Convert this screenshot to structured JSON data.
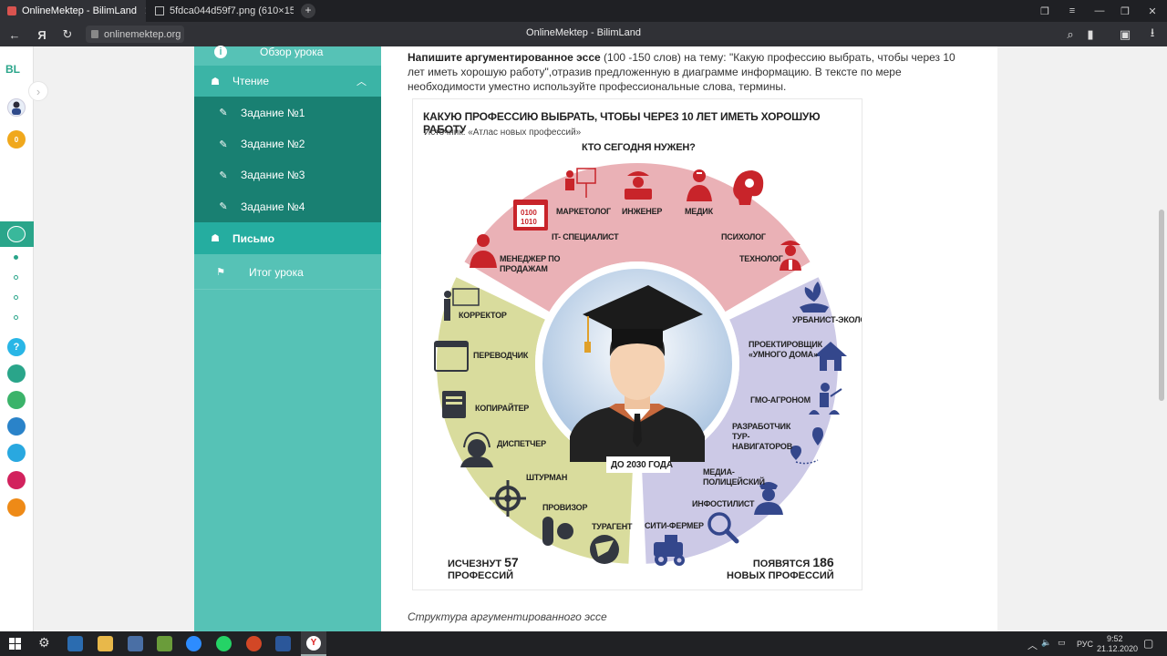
{
  "browser": {
    "tabs": [
      {
        "title": "OnlineMektep - BilimLand",
        "active": true
      },
      {
        "title": "5fdca044d59f7.png (610×15",
        "active": false
      }
    ],
    "url": "onlinemektep.org",
    "page_title": "OnlineMektep - BilimLand"
  },
  "rail": {
    "logo": "BL",
    "points": "0"
  },
  "sidebar": {
    "overview_label": "Обзор урока",
    "reading_label": "Чтение",
    "tasks": [
      "Задание №1",
      "Задание №2",
      "Задание №3",
      "Задание №4"
    ],
    "writing_label": "Письмо",
    "result_label": "Итог урока"
  },
  "content": {
    "task_bold": "Напишите аргументированное эссе",
    "task_rest": " (100 -150 слов) на тему: \"Какую профессию выбрать, чтобы через 10 лет иметь хорошую работу\",отразив предложенную в диаграмме информацию. В тексте по мере необходимости уместно используйте профессиональные слова, термины.",
    "caption": "Структура аргументированного эссе"
  },
  "infographic": {
    "title": "КАКУЮ ПРОФЕССИЮ ВЫБРАТЬ, ЧТОБЫ ЧЕРЕЗ 10 ЛЕТ ИМЕТЬ ХОРОШУЮ РАБОТУ",
    "source": "Источник: «Атлас новых профессий»",
    "needed_title": "КТО СЕГОДНЯ НУЖЕН?",
    "center_label": "ДО 2030 ГОДА",
    "needed": [
      "МАРКЕТОЛОГ",
      "ИНЖЕНЕР",
      "МЕДИК",
      "IT- СПЕЦИАЛИСТ",
      "ПСИХОЛОГ",
      "МЕНЕДЖЕР ПО ПРОДАЖАМ",
      "ТЕХНОЛОГ"
    ],
    "disappear": [
      "КОРРЕКТОР",
      "ПЕРЕВОДЧИК",
      "КОПИРАЙТЕР",
      "ДИСПЕТЧЕР",
      "ШТУРМАН",
      "ПРОВИЗОР",
      "ТУРАГЕНТ"
    ],
    "appear": [
      "УРБАНИСТ-ЭКОЛОГ",
      "ПРОЕКТИРОВЩИК «УМНОГО ДОМА»",
      "ГМО-АГРОНОМ",
      "РАЗРАБОТЧИК ТУР-НАВИГАТОРОВ",
      "МЕДИА- ПОЛИЦЕЙСКИЙ",
      "ИНФОСТИЛИСТ",
      "СИТИ-ФЕРМЕР"
    ],
    "disappear_text": "ИСЧЕЗНУТ",
    "disappear_num": "57",
    "disappear_sub": "ПРОФЕССИЙ",
    "appear_text": "ПОЯВЯТСЯ",
    "appear_num": "186",
    "appear_sub": "НОВЫХ ПРОФЕССИЙ",
    "chip_text": "0100 1010",
    "colors": {
      "needed": "#eab1b6",
      "disappear": "#d9dc9d",
      "appear": "#ccc9e6",
      "icon_red": "#c8242a",
      "icon_dark": "#333740",
      "icon_blue": "#34478c"
    }
  },
  "taskbar": {
    "lang": "РУС",
    "time": "9:52",
    "date": "21.12.2020"
  }
}
